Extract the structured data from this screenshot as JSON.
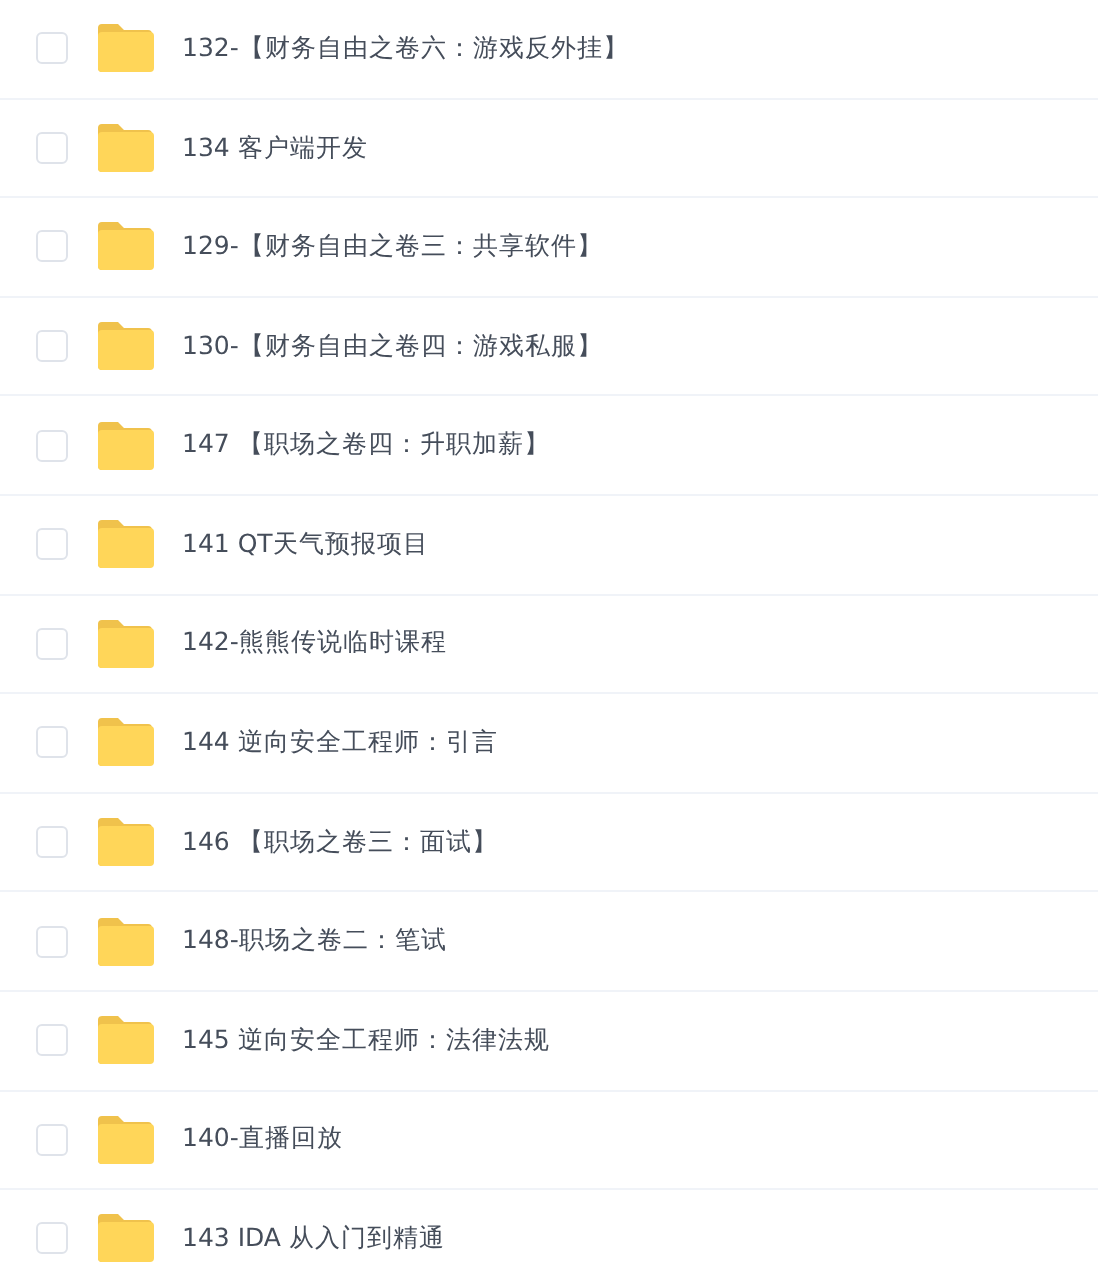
{
  "files": [
    {
      "name": "132-【财务自由之卷六：游戏反外挂】",
      "checked": false
    },
    {
      "name": "134 客户端开发",
      "checked": false
    },
    {
      "name": "129-【财务自由之卷三：共享软件】",
      "checked": false
    },
    {
      "name": "130-【财务自由之卷四：游戏私服】",
      "checked": false
    },
    {
      "name": "147 【职场之卷四：升职加薪】",
      "checked": false
    },
    {
      "name": "141 QT天气预报项目",
      "checked": false
    },
    {
      "name": "142-熊熊传说临时课程",
      "checked": false
    },
    {
      "name": "144 逆向安全工程师：引言",
      "checked": false
    },
    {
      "name": "146 【职场之卷三：面试】",
      "checked": false
    },
    {
      "name": "148-职场之卷二：笔试",
      "checked": false
    },
    {
      "name": "145 逆向安全工程师：法律法规",
      "checked": false
    },
    {
      "name": "140-直播回放",
      "checked": false
    },
    {
      "name": "143 IDA 从入门到精通",
      "checked": false
    }
  ]
}
